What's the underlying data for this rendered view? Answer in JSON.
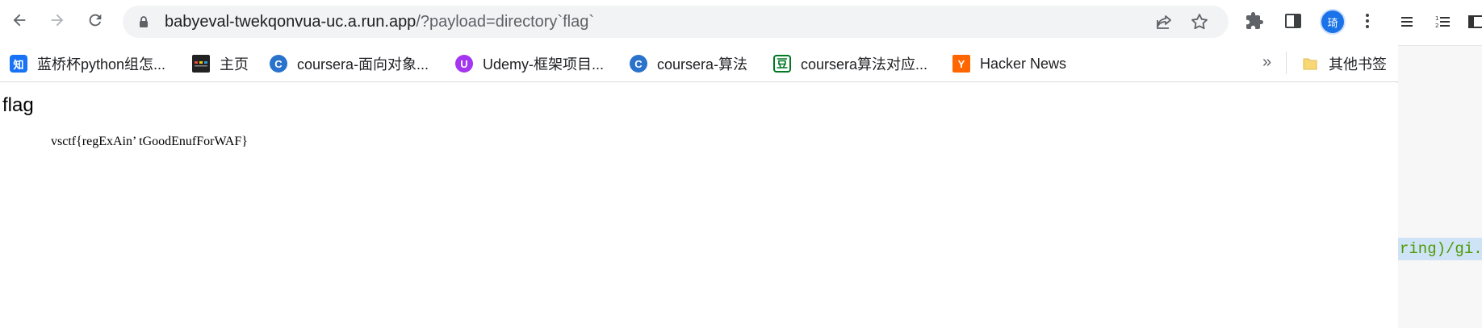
{
  "browser": {
    "url_host": "babyeval-twekqonvua-uc.a.run.app",
    "url_path": "/?payload=directory`flag`",
    "avatar_text": "琦"
  },
  "bookmarks": [
    {
      "label": "蓝桥杯python组怎...",
      "icon": "zhihu-icon",
      "color": "#1772f6",
      "glyph": "知"
    },
    {
      "label": "主页",
      "icon": "home-page-icon",
      "color": "#222222",
      "glyph": ""
    },
    {
      "label": "coursera-面向对象...",
      "icon": "coursera-icon",
      "color": "#2a73cc",
      "glyph": "C"
    },
    {
      "label": "Udemy-框架项目...",
      "icon": "udemy-icon",
      "color": "#a435f0",
      "glyph": "U"
    },
    {
      "label": "coursera-算法",
      "icon": "coursera-icon",
      "color": "#2a73cc",
      "glyph": "C"
    },
    {
      "label": "coursera算法对应...",
      "icon": "douban-icon",
      "color": "#007722",
      "glyph": "豆"
    },
    {
      "label": "Hacker News",
      "icon": "hacker-news-icon",
      "color": "#ff6600",
      "glyph": "Y"
    }
  ],
  "other_bookmarks": "其他书签",
  "more_bookmarks": "»",
  "page": {
    "heading": "flag",
    "flag_text": "vsctf{regExAin’ tGoodEnufForWAF}"
  },
  "side_editor": {
    "code_fragment": "ring)/gi.("
  }
}
